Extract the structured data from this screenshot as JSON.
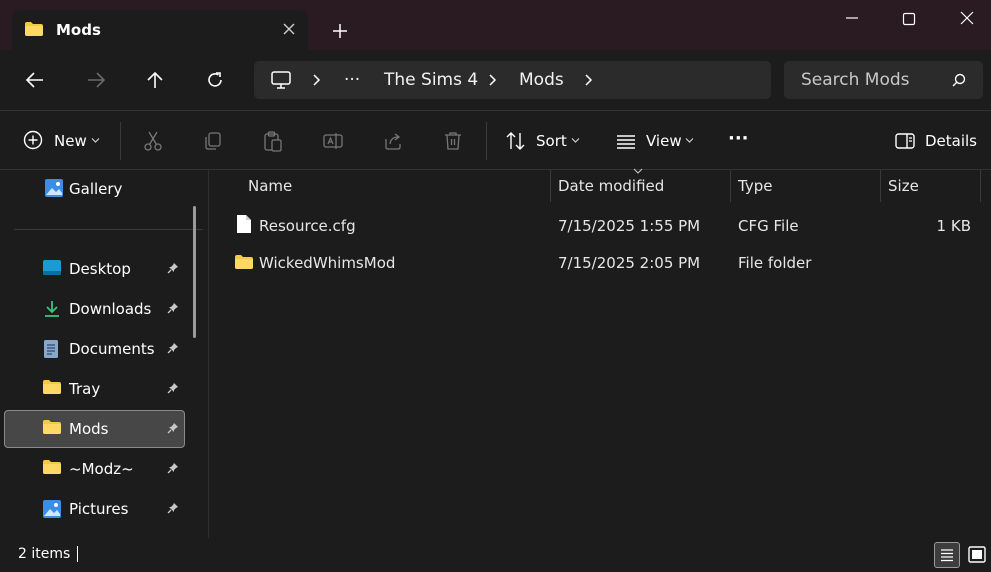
{
  "window": {
    "tab_title": "Mods",
    "colors": {
      "titlebar": "#2a1a22",
      "folder": "#f6c84a"
    }
  },
  "address": {
    "crumbs": [
      "The Sims 4",
      "Mods"
    ],
    "overflow": "···",
    "search_placeholder": "Search Mods"
  },
  "toolbar": {
    "new_label": "New",
    "sort_label": "Sort",
    "view_label": "View",
    "more_label": "···",
    "details_label": "Details"
  },
  "sidebar": {
    "gallery": "Gallery",
    "items": [
      {
        "label": "Desktop",
        "icon": "desktop-icon"
      },
      {
        "label": "Downloads",
        "icon": "download-icon"
      },
      {
        "label": "Documents",
        "icon": "document-icon"
      },
      {
        "label": "Tray",
        "icon": "folder-icon"
      },
      {
        "label": "Mods",
        "icon": "folder-icon",
        "selected": true
      },
      {
        "label": "~Modz~",
        "icon": "folder-icon"
      },
      {
        "label": "Pictures",
        "icon": "pictures-icon"
      }
    ]
  },
  "columns": {
    "name": "Name",
    "date": "Date modified",
    "type": "Type",
    "size": "Size"
  },
  "files": [
    {
      "name": "Resource.cfg",
      "date": "7/15/2025 1:55 PM",
      "type": "CFG File",
      "size": "1 KB",
      "icon": "file-icon"
    },
    {
      "name": "WickedWhimsMod",
      "date": "7/15/2025 2:05 PM",
      "type": "File folder",
      "size": "",
      "icon": "folder-icon"
    }
  ],
  "status": {
    "count": "2 items"
  }
}
